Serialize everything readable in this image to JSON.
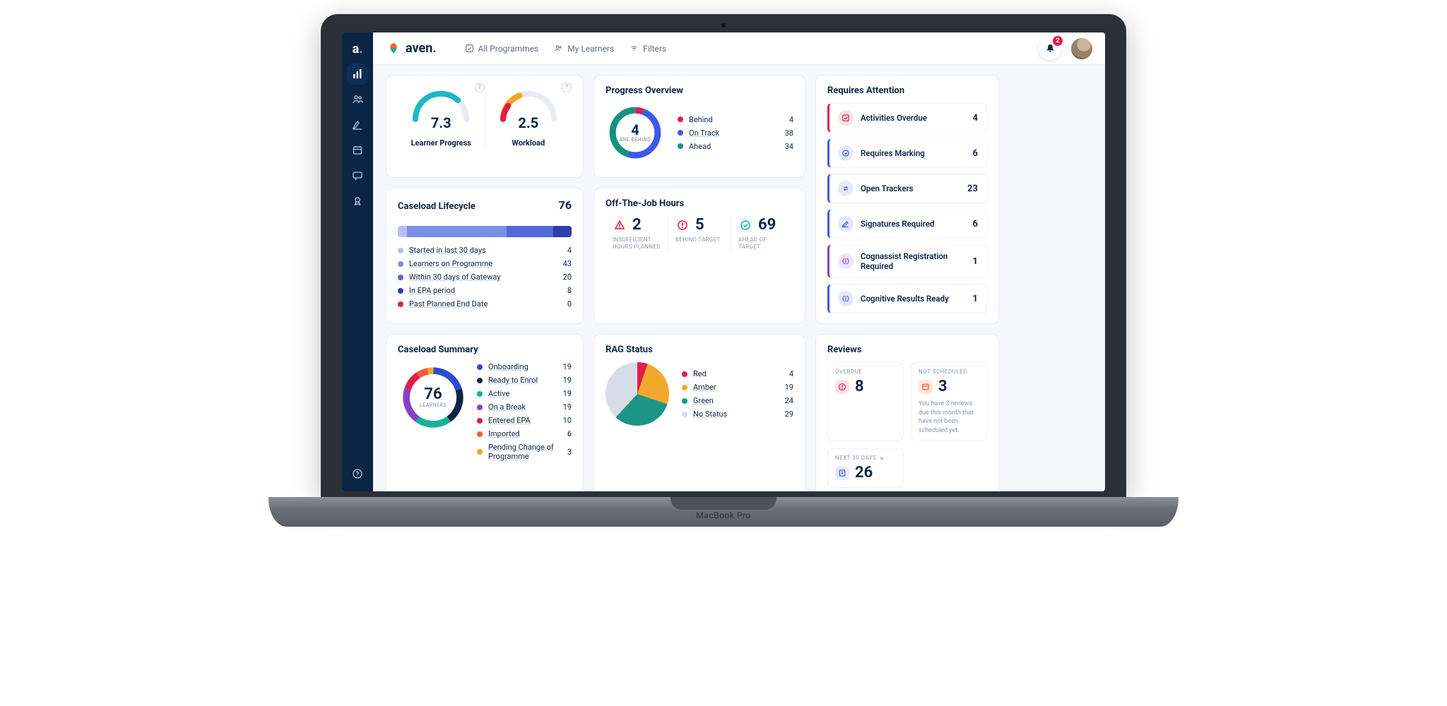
{
  "brand": {
    "name": "aven."
  },
  "device_label": "MacBook Pro",
  "notifications": {
    "count": 2
  },
  "topnav": {
    "all_programmes": "All Programmes",
    "my_learners": "My Learners",
    "filters": "Filters"
  },
  "gauges": {
    "learner_progress": {
      "value": "7.3",
      "label": "Learner Progress",
      "fraction": 0.73
    },
    "workload": {
      "value": "2.5",
      "label": "Workload",
      "fraction": 0.25
    }
  },
  "caseload_lifecycle": {
    "title": "Caseload Lifecycle",
    "total": 76,
    "items": [
      {
        "label": "Started in last 30 days",
        "value": 4,
        "color": "#b4c0f0"
      },
      {
        "label": "Learners on Programme",
        "value": 43,
        "color": "#7b90e3"
      },
      {
        "label": "Within 30 days of Gateway",
        "value": 20,
        "color": "#5367d7"
      },
      {
        "label": "In EPA period",
        "value": 8,
        "color": "#2f3ea8"
      },
      {
        "label": "Past Planned End Date",
        "value": 0,
        "color": "#e11d48"
      }
    ]
  },
  "caseload_summary": {
    "title": "Caseload Summary",
    "center_value": 76,
    "center_label": "LEARNERS",
    "items": [
      {
        "label": "Onboarding",
        "value": 19,
        "color": "#2f49d1"
      },
      {
        "label": "Ready to Enrol",
        "value": 19,
        "color": "#0b2545"
      },
      {
        "label": "Active",
        "value": 19,
        "color": "#16b19a"
      },
      {
        "label": "On a Break",
        "value": 19,
        "color": "#8b3fc7"
      },
      {
        "label": "Entered EPA",
        "value": 10,
        "color": "#e11d48"
      },
      {
        "label": "Imported",
        "value": 6,
        "color": "#f25c3b"
      },
      {
        "label": "Pending Change of Programme",
        "value": 3,
        "color": "#f5a524"
      }
    ]
  },
  "progress_overview": {
    "title": "Progress Overview",
    "center_value": 4,
    "center_label": "ARE BEHIND",
    "items": [
      {
        "label": "Behind",
        "value": 4,
        "color": "#e11d48",
        "link": false
      },
      {
        "label": "On Track",
        "value": 38,
        "color": "#3b5be8",
        "link": true
      },
      {
        "label": "Ahead",
        "value": 34,
        "color": "#14937f",
        "link": false
      }
    ]
  },
  "otj": {
    "title": "Off-The-Job Hours",
    "cells": [
      {
        "value": 2,
        "caption": "INSUFFICIENT HOURS PLANNED",
        "icon": "warning-triangle",
        "color": "#e11d48"
      },
      {
        "value": 5,
        "caption": "BEHIND TARGET",
        "icon": "alert-circle",
        "color": "#e11d48"
      },
      {
        "value": 69,
        "caption": "AHEAD OF TARGET",
        "icon": "check-circle",
        "color": "#14b5a1"
      }
    ]
  },
  "rag": {
    "title": "RAG Status",
    "items": [
      {
        "label": "Red",
        "value": 4,
        "color": "#e11d48"
      },
      {
        "label": "Amber",
        "value": 19,
        "color": "#f2a92b"
      },
      {
        "label": "Green",
        "value": 24,
        "color": "#1c9586"
      },
      {
        "label": "No Status",
        "value": 29,
        "color": "#d7dde7"
      }
    ]
  },
  "attention": {
    "title": "Requires Attention",
    "items": [
      {
        "label": "Activities Overdue",
        "count": 4,
        "accent": "#e11d48",
        "icon": "check-square"
      },
      {
        "label": "Requires Marking",
        "count": 6,
        "accent": "#3b5be8",
        "icon": "check-circle"
      },
      {
        "label": "Open Trackers",
        "count": 23,
        "accent": "#3b5be8",
        "icon": "swap"
      },
      {
        "label": "Signatures Required",
        "count": 6,
        "accent": "#3b5be8",
        "icon": "pen"
      },
      {
        "label": "Cognassist Registration Required",
        "count": 1,
        "accent": "#8b3fc7",
        "icon": "brain"
      },
      {
        "label": "Cognitive Results Ready",
        "count": 1,
        "accent": "#3b5be8",
        "icon": "brain"
      }
    ]
  },
  "reviews": {
    "title": "Reviews",
    "overdue": {
      "label": "OVERDUE",
      "value": 8
    },
    "not_scheduled": {
      "label": "NOT SCHEDULED",
      "value": 3
    },
    "next30": {
      "label": "NEXT 30 DAYS",
      "value": 26
    },
    "note": "You have 3 reviews due this month that have not been scheduled yet."
  },
  "chart_data": [
    {
      "type": "bar",
      "name": "Caseload Lifecycle stacked bar",
      "categories": [
        "Started in last 30 days",
        "Learners on Programme",
        "Within 30 days of Gateway",
        "In EPA period",
        "Past Planned End Date"
      ],
      "values": [
        4,
        43,
        20,
        8,
        0
      ],
      "total": 76
    },
    {
      "type": "pie",
      "name": "Caseload Summary donut",
      "categories": [
        "Onboarding",
        "Ready to Enrol",
        "Active",
        "On a Break",
        "Entered EPA",
        "Imported",
        "Pending Change of Programme"
      ],
      "values": [
        19,
        19,
        19,
        19,
        10,
        6,
        3
      ],
      "center_value": 76,
      "center_label": "LEARNERS"
    },
    {
      "type": "pie",
      "name": "Progress Overview donut",
      "categories": [
        "Behind",
        "On Track",
        "Ahead"
      ],
      "values": [
        4,
        38,
        34
      ],
      "center_value": 4,
      "center_label": "ARE BEHIND"
    },
    {
      "type": "pie",
      "name": "RAG Status pie",
      "categories": [
        "Red",
        "Amber",
        "Green",
        "No Status"
      ],
      "values": [
        4,
        19,
        24,
        29
      ]
    },
    {
      "type": "bar",
      "name": "Learner Progress gauge",
      "categories": [
        "score"
      ],
      "values": [
        7.3
      ],
      "ylim": [
        0,
        10
      ]
    },
    {
      "type": "bar",
      "name": "Workload gauge",
      "categories": [
        "score"
      ],
      "values": [
        2.5
      ],
      "ylim": [
        0,
        10
      ]
    }
  ]
}
